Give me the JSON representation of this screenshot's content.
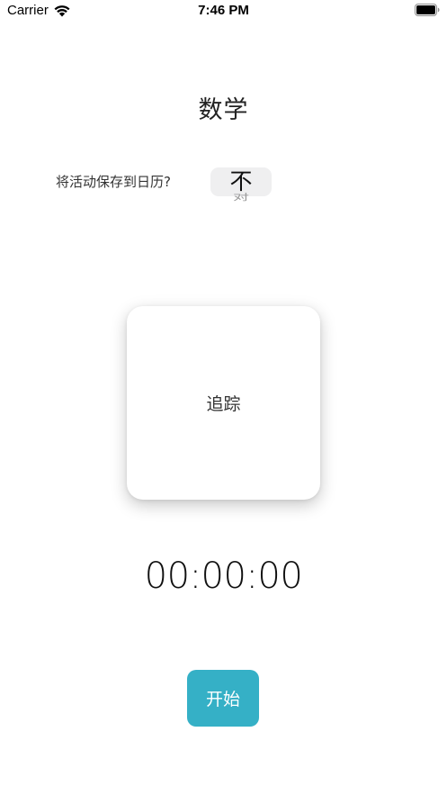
{
  "status_bar": {
    "carrier": "Carrier",
    "time": "7:46 PM",
    "wifi_icon": "wifi-icon",
    "battery_icon": "battery-icon"
  },
  "title": "数学",
  "save_to_calendar": {
    "label": "将活动保存到日历?",
    "selected_option": "不",
    "next_option": "对"
  },
  "track_card": {
    "label": "追踪"
  },
  "timer": {
    "value": "00:00:00"
  },
  "start_button": {
    "label": "开始"
  },
  "colors": {
    "accent": "#35b0c6",
    "background": "#ffffff",
    "picker_highlight": "#efeff0"
  }
}
